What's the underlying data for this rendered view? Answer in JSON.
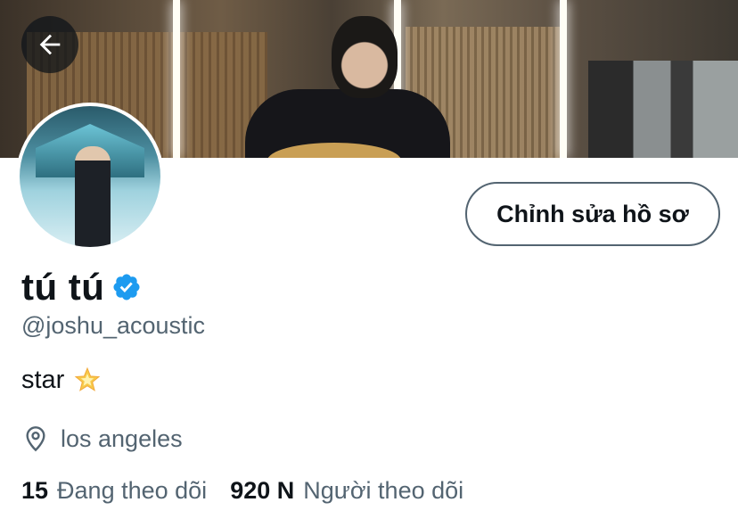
{
  "header": {
    "back_icon": "arrow-left-icon",
    "banner_alt": "profile banner photo"
  },
  "profile": {
    "edit_button_label": "Chỉnh sửa hồ sơ",
    "display_name": "tú tú",
    "verified_icon": "verified-badge-icon",
    "handle": "@joshu_acoustic",
    "bio_text": "star",
    "bio_emoji_icon": "glowing-star-icon",
    "location_icon": "location-pin-icon",
    "location": "los angeles"
  },
  "stats": {
    "following_count": "15",
    "following_label": "Đang theo dõi",
    "followers_count": "920 N",
    "followers_label": "Người theo dõi"
  },
  "colors": {
    "text_primary": "#0f1419",
    "text_secondary": "#536471",
    "verified_blue": "#1d9bf0",
    "background": "#ffffff"
  }
}
